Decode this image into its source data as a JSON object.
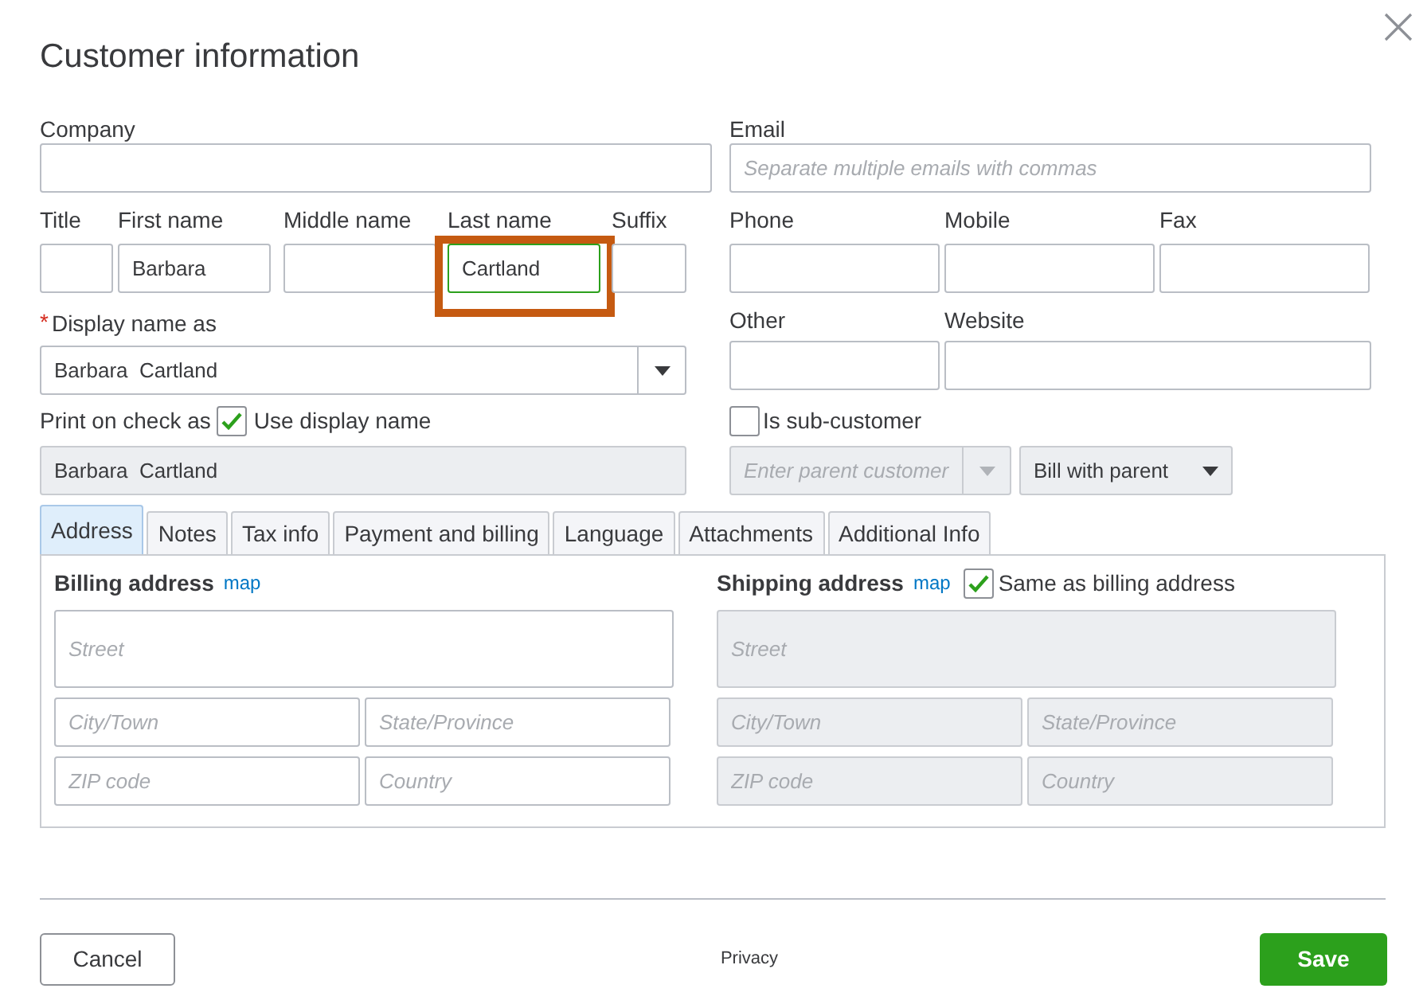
{
  "dialog": {
    "title": "Customer information"
  },
  "company": {
    "label": "Company"
  },
  "email": {
    "label": "Email",
    "placeholder": "Separate multiple emails with commas"
  },
  "name_fields": [
    {
      "label": "Title",
      "focused": false,
      "highlighted": false
    },
    {
      "label": "First name",
      "value": "Barbara",
      "focused": false,
      "highlighted": false
    },
    {
      "label": "Middle name",
      "focused": false,
      "highlighted": false
    },
    {
      "label": "Last name",
      "value": "Cartland",
      "focused": true,
      "highlighted": true
    },
    {
      "label": "Suffix",
      "focused": false,
      "highlighted": false
    }
  ],
  "phone_fields": [
    {
      "label": "Phone"
    },
    {
      "label": "Mobile"
    },
    {
      "label": "Fax"
    }
  ],
  "display_name": {
    "label": "Display name as",
    "required_mark": "*",
    "value": "Barbara  Cartland"
  },
  "other": {
    "label": "Other"
  },
  "website": {
    "label": "Website"
  },
  "print_on_check": {
    "label": "Print on check as",
    "checkbox_label": "Use display name",
    "checked": true,
    "value": "Barbara  Cartland",
    "disabled": true
  },
  "sub_customer": {
    "label": "Is sub-customer",
    "checked": false,
    "parent_placeholder": "Enter parent customer",
    "parent_disabled": true,
    "bill_option": "Bill with parent"
  },
  "tabs": [
    {
      "label": "Address",
      "selected": true
    },
    {
      "label": "Notes",
      "selected": false
    },
    {
      "label": "Tax info",
      "selected": false
    },
    {
      "label": "Payment and billing",
      "selected": false
    },
    {
      "label": "Language",
      "selected": false
    },
    {
      "label": "Attachments",
      "selected": false
    },
    {
      "label": "Additional Info",
      "selected": false
    }
  ],
  "billing": {
    "title": "Billing address",
    "link": "map",
    "disabled": false,
    "fields": [
      {
        "placeholder": "Street"
      },
      {
        "placeholder": "City/Town"
      },
      {
        "placeholder": "State/Province"
      },
      {
        "placeholder": "ZIP code"
      },
      {
        "placeholder": "Country"
      }
    ]
  },
  "shipping": {
    "title": "Shipping address",
    "link": "map",
    "same_label": "Same as billing address",
    "same_checked": true,
    "disabled": true,
    "fields": [
      {
        "placeholder": "Street"
      },
      {
        "placeholder": "City/Town"
      },
      {
        "placeholder": "State/Province"
      },
      {
        "placeholder": "ZIP code"
      },
      {
        "placeholder": "Country"
      }
    ]
  },
  "footer": {
    "cancel": "Cancel",
    "privacy": "Privacy",
    "save": "Save"
  }
}
